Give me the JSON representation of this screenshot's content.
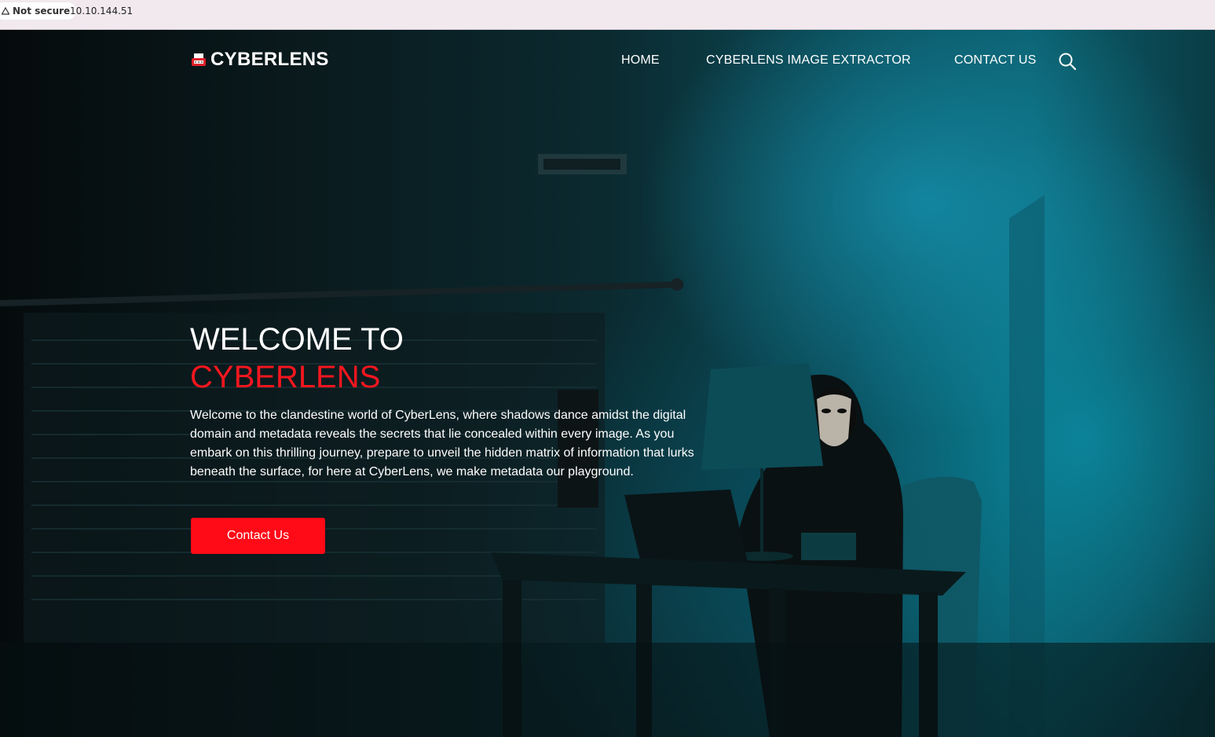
{
  "browser": {
    "security_label": "Not secure",
    "url": "10.10.144.51"
  },
  "header": {
    "brand": "CYBERLENS",
    "nav": [
      {
        "label": "HOME"
      },
      {
        "label": "CYBERLENS IMAGE EXTRACTOR"
      },
      {
        "label": "CONTACT US"
      }
    ],
    "search_icon": "search-icon"
  },
  "hero": {
    "title_line1": "WELCOME TO",
    "title_line2": "CYBERLENS",
    "intro": "Welcome to the clandestine world of CyberLens, where shadows dance amidst the digital domain and metadata reveals the secrets that lie concealed within every image. As you embark on this thrilling journey, prepare to unveil the hidden matrix of information that lurks beneath the surface, for here at CyberLens, we make metadata our playground.",
    "cta_label": "Contact Us"
  },
  "colors": {
    "accent": "#ff0a17",
    "title_accent": "#f5161f",
    "text": "#ffffff",
    "addressbar": "#f1e9ee"
  }
}
